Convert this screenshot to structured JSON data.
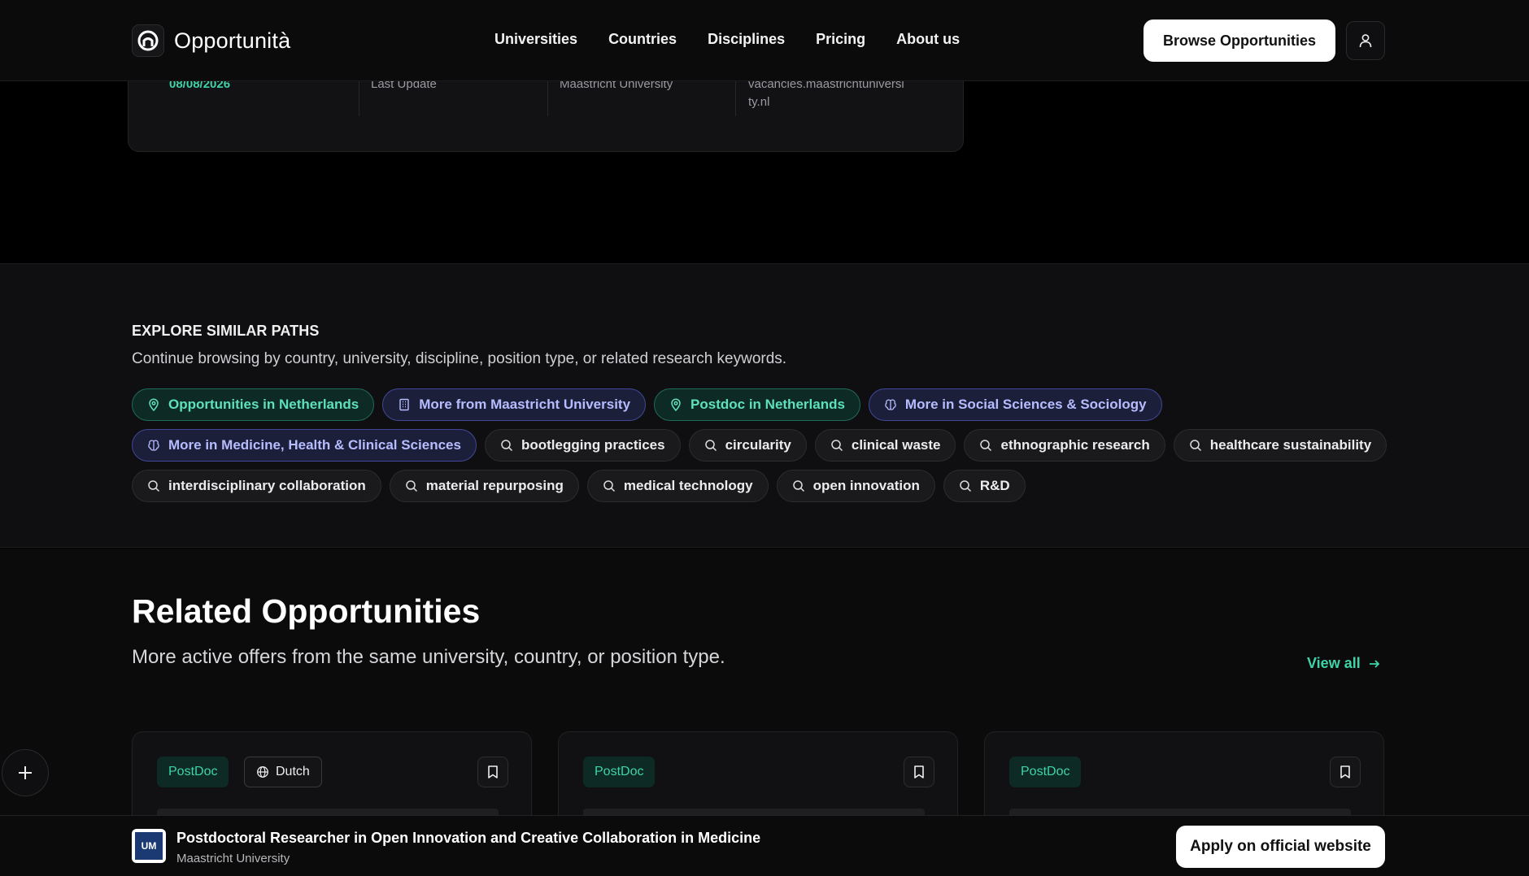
{
  "header": {
    "brand": "Opportunità",
    "nav": [
      "Universities",
      "Countries",
      "Disciplines",
      "Pricing",
      "About us"
    ],
    "browse_label": "Browse Opportunities"
  },
  "info_card": {
    "date": "08/08/2026",
    "last_update": "Last Update",
    "university": "Maastricht University",
    "website_line1": "vacancies.maastrichtuniversi",
    "website_line2": "ty.nl"
  },
  "explore": {
    "title": "EXPLORE SIMILAR PATHS",
    "subtitle": "Continue browsing by country, university, discipline, position type, or related research keywords.",
    "chips": [
      {
        "label": "Opportunities in Netherlands",
        "style": "green",
        "icon": "map-pin-icon"
      },
      {
        "label": "More from Maastricht University",
        "style": "indigo",
        "icon": "building-icon"
      },
      {
        "label": "Postdoc in Netherlands",
        "style": "green",
        "icon": "map-pin-icon"
      },
      {
        "label": "More in Social Sciences & Sociology",
        "style": "indigo",
        "icon": "brain-icon"
      },
      {
        "label": "More in Medicine, Health & Clinical Sciences",
        "style": "indigo",
        "icon": "brain-icon"
      },
      {
        "label": "bootlegging practices",
        "style": "plain",
        "icon": "search-icon"
      },
      {
        "label": "circularity",
        "style": "plain",
        "icon": "search-icon"
      },
      {
        "label": "clinical waste",
        "style": "plain",
        "icon": "search-icon"
      },
      {
        "label": "ethnographic research",
        "style": "plain",
        "icon": "search-icon"
      },
      {
        "label": "healthcare sustainability",
        "style": "plain",
        "icon": "search-icon"
      },
      {
        "label": "interdisciplinary collaboration",
        "style": "plain",
        "icon": "search-icon"
      },
      {
        "label": "material repurposing",
        "style": "plain",
        "icon": "search-icon"
      },
      {
        "label": "medical technology",
        "style": "plain",
        "icon": "search-icon"
      },
      {
        "label": "open innovation",
        "style": "plain",
        "icon": "search-icon"
      },
      {
        "label": "R&D",
        "style": "plain",
        "icon": "search-icon"
      }
    ]
  },
  "related": {
    "title": "Related Opportunities",
    "subtitle": "More active offers from the same university, country, or position type.",
    "view_all": "View all",
    "cards": [
      {
        "type": "PostDoc",
        "language": "Dutch"
      },
      {
        "type": "PostDoc"
      },
      {
        "type": "PostDoc"
      }
    ]
  },
  "bottom_bar": {
    "title": "Postdoctoral Researcher in Open Innovation and Creative Collaboration in Medicine",
    "university": "Maastricht University",
    "logo_text": "UM",
    "apply_label": "Apply on official website"
  },
  "colors": {
    "accent_green": "#3fd3a8",
    "chip_green_bg": "#0d2a24",
    "chip_indigo_bg": "#1c1f3a",
    "background": "#000000"
  }
}
